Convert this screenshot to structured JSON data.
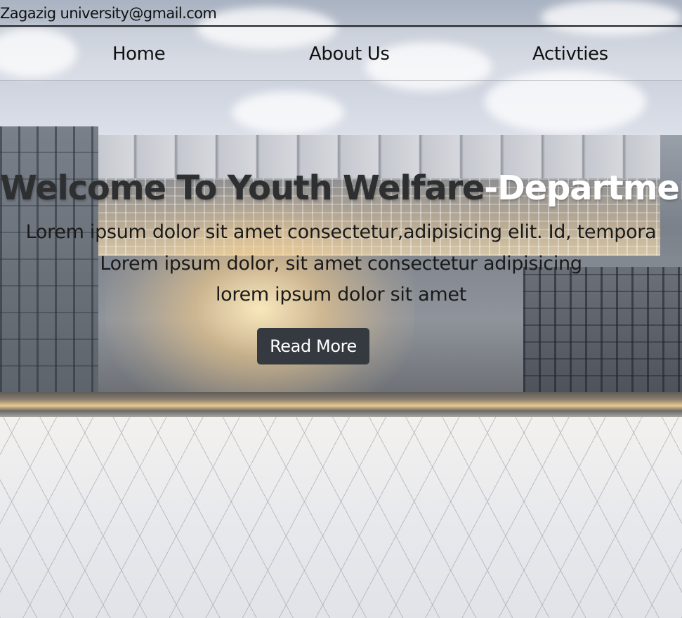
{
  "topbar": {
    "email": "Zagazig university@gmail.com"
  },
  "nav": {
    "items": [
      {
        "label": "Home"
      },
      {
        "label": "About Us"
      },
      {
        "label": "Activties"
      }
    ]
  },
  "hero": {
    "title_part1": "Welcome To Youth Welfare",
    "title_part2": "-Department",
    "lines": [
      "Lorem ipsum dolor sit amet consectetur,adipisicing elit. Id, tempora",
      "Lorem ipsum dolor, sit amet consectetur adipisicing",
      "lorem ipsum dolor sit amet"
    ],
    "button_label": "Read More"
  },
  "colors": {
    "button_bg": "#343a40",
    "title_dark": "#2e2f31",
    "title_light": "#ffffff"
  }
}
